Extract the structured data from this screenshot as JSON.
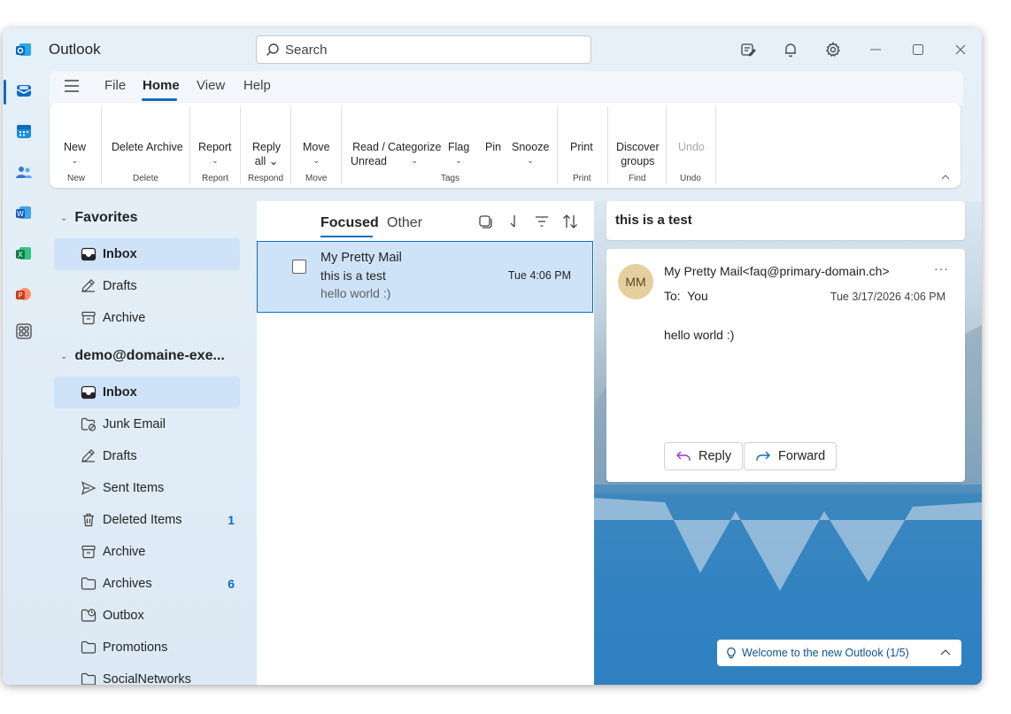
{
  "app": {
    "title": "Outlook"
  },
  "search": {
    "placeholder": "Search"
  },
  "menu": {
    "items": [
      "File",
      "Home",
      "View",
      "Help"
    ],
    "active": "Home"
  },
  "ribbon": {
    "buttons": {
      "new": "New",
      "delete": "Delete",
      "archive": "Archive",
      "report": "Report",
      "reply_all_1": "Reply",
      "reply_all_2": "all",
      "move": "Move",
      "read_unread_1": "Read /",
      "read_unread_2": "Unread",
      "categorize": "Categorize",
      "flag": "Flag",
      "pin": "Pin",
      "snooze": "Snooze",
      "print": "Print",
      "discover_1": "Discover",
      "discover_2": "groups",
      "undo": "Undo"
    },
    "groups": {
      "new": "New",
      "delete": "Delete",
      "report": "Report",
      "respond": "Respond",
      "move": "Move",
      "tags": "Tags",
      "print": "Print",
      "find": "Find",
      "undo": "Undo"
    }
  },
  "favorites": {
    "header": "Favorites",
    "items": [
      {
        "label": "Inbox",
        "icon": "inbox-icon"
      },
      {
        "label": "Drafts",
        "icon": "drafts-icon"
      },
      {
        "label": "Archive",
        "icon": "archive-icon"
      }
    ]
  },
  "account": {
    "header": "demo@domaine-exe...",
    "items": [
      {
        "label": "Inbox",
        "icon": "inbox-icon",
        "count": ""
      },
      {
        "label": "Junk Email",
        "icon": "junk-icon",
        "count": ""
      },
      {
        "label": "Drafts",
        "icon": "drafts-icon",
        "count": ""
      },
      {
        "label": "Sent Items",
        "icon": "send-icon",
        "count": ""
      },
      {
        "label": "Deleted Items",
        "icon": "trash-icon",
        "count": "1"
      },
      {
        "label": "Archive",
        "icon": "archive-icon",
        "count": ""
      },
      {
        "label": "Archives",
        "icon": "folder-icon",
        "count": "6"
      },
      {
        "label": "Outbox",
        "icon": "outbox-icon",
        "count": ""
      },
      {
        "label": "Promotions",
        "icon": "folder-icon",
        "count": ""
      },
      {
        "label": "SocialNetworks",
        "icon": "folder-icon",
        "count": ""
      }
    ]
  },
  "mail_list": {
    "tabs": {
      "focused": "Focused",
      "other": "Other"
    },
    "messages": [
      {
        "from": "My Pretty Mail",
        "subject": "this is a test",
        "preview": "hello world :)",
        "time": "Tue 4:06 PM"
      }
    ]
  },
  "reading": {
    "subject": "this is a test",
    "avatar_initials": "MM",
    "from": "My Pretty Mail<faq@primary-domain.ch>",
    "to_label": "To:",
    "to": "You",
    "date": "Tue 3/17/2026 4:06 PM",
    "body": "hello world :)",
    "reply": "Reply",
    "forward": "Forward",
    "more": "···"
  },
  "welcome": {
    "text": "Welcome to the new Outlook (1/5)"
  },
  "colors": {
    "accent": "#0f6cbd",
    "selected": "#cfe3f8",
    "avatar": "#e6cf9e"
  }
}
